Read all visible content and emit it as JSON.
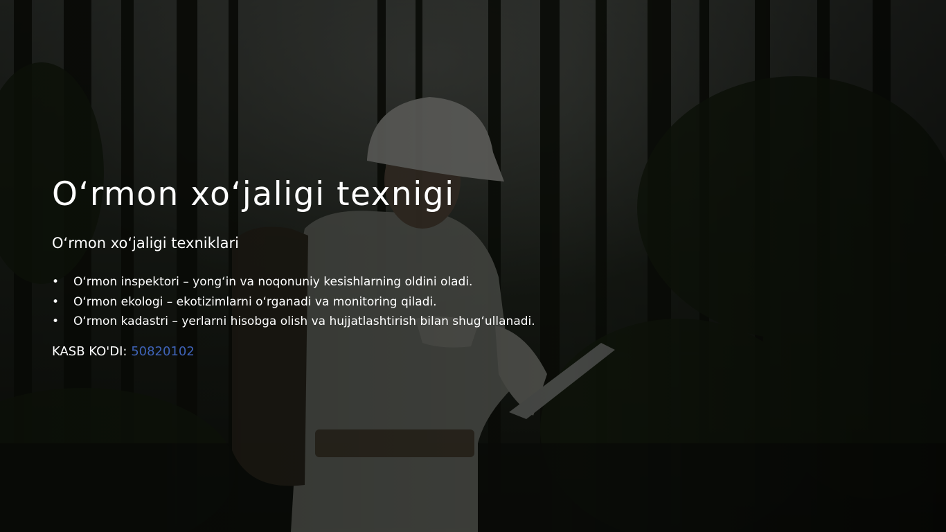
{
  "slide": {
    "title": "O‘rmon xo‘jaligi texnigi",
    "subtitle": "O‘rmon xo‘jaligi texniklari",
    "bullets": [
      "O‘rmon inspektori – yong‘in va noqonuniy kesishlarning oldini oladi.",
      "O‘rmon ekologi – ekotizimlarni o‘rganadi va monitoring qiladi.",
      "O‘rmon kadastri – yerlarni hisobga olish va hujjatlashtirish bilan shug‘ullanadi."
    ],
    "bullet_marker": "•",
    "code_label": "KASB KO'DI: ",
    "code_value": "50820102"
  },
  "colors": {
    "overlay": "#000000",
    "text": "#ffffff",
    "code_value": "#3f63b8"
  },
  "background": {
    "icon": "forest-worker-photo"
  }
}
